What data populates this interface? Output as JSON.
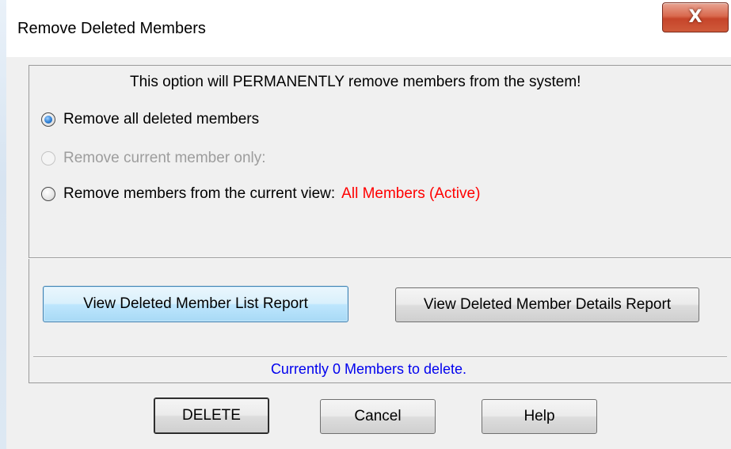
{
  "window": {
    "title": "Remove Deleted Members",
    "close_glyph": "X"
  },
  "warning": "This option will PERMANENTLY remove members from the system!",
  "options": [
    {
      "label": "Remove all deleted members",
      "checked": true,
      "enabled": true
    },
    {
      "label": "Remove current member only:",
      "checked": false,
      "enabled": false
    },
    {
      "label": "Remove members from the current view:",
      "checked": false,
      "enabled": true,
      "view_name": "All Members (Active)"
    }
  ],
  "reports": {
    "list_button": "View Deleted Member List Report",
    "details_button": "View Deleted Member Details Report"
  },
  "status": "Currently 0 Members to delete.",
  "footer": {
    "delete": "DELETE",
    "cancel": "Cancel",
    "help": "Help"
  },
  "colors": {
    "view_name": "#ff0000",
    "status": "#0000ee",
    "close_button": "#c6452a",
    "focused_button": "#bee6fd"
  }
}
